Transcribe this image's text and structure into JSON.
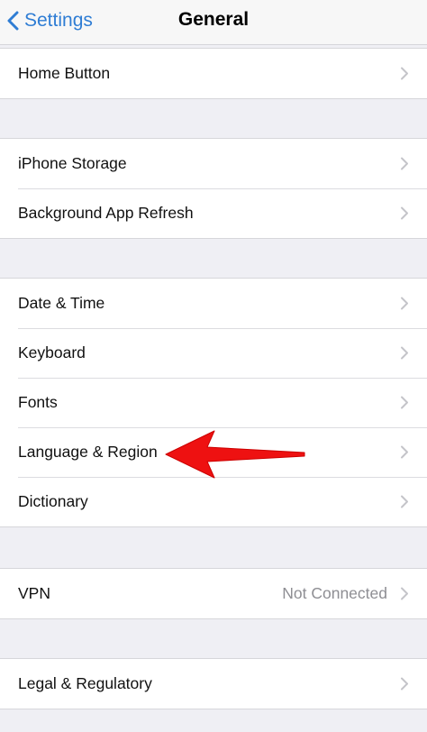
{
  "nav": {
    "back_label": "Settings",
    "title": "General"
  },
  "groups": [
    {
      "rows": [
        {
          "label": "Home Button"
        }
      ]
    },
    {
      "rows": [
        {
          "label": "iPhone Storage"
        },
        {
          "label": "Background App Refresh"
        }
      ]
    },
    {
      "rows": [
        {
          "label": "Date & Time"
        },
        {
          "label": "Keyboard"
        },
        {
          "label": "Fonts"
        },
        {
          "label": "Language & Region"
        },
        {
          "label": "Dictionary"
        }
      ]
    },
    {
      "rows": [
        {
          "label": "VPN",
          "value": "Not Connected"
        }
      ]
    },
    {
      "rows": [
        {
          "label": "Legal & Regulatory"
        }
      ]
    }
  ],
  "icons": {
    "back": "chevron-left-icon",
    "row": "chevron-right-icon"
  },
  "colors": {
    "accent": "#2f7dd4",
    "annotation": "#ee1111",
    "background": "#efeff4"
  }
}
